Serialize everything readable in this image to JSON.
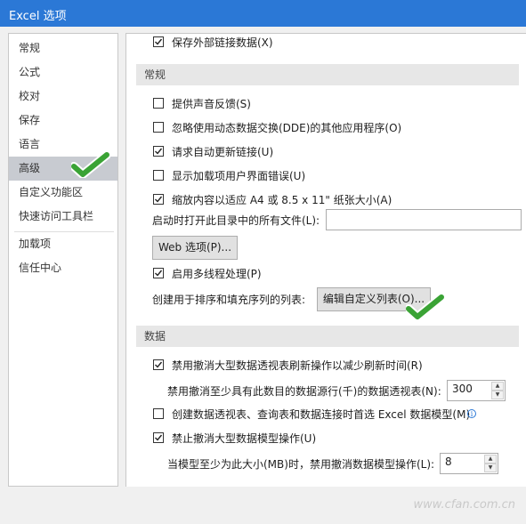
{
  "window": {
    "title": "Excel 选项"
  },
  "sidebar": {
    "items": [
      {
        "label": "常规"
      },
      {
        "label": "公式"
      },
      {
        "label": "校对"
      },
      {
        "label": "保存"
      },
      {
        "label": "语言"
      },
      {
        "label": "高级"
      },
      {
        "label": "自定义功能区"
      },
      {
        "label": "快速访问工具栏"
      },
      {
        "label": "加载项"
      },
      {
        "label": "信任中心"
      }
    ],
    "active": "高级"
  },
  "main": {
    "top_option": {
      "label": "保存外部链接数据(X)",
      "checked": true
    },
    "general": {
      "header": "常规",
      "options": [
        {
          "label": "提供声音反馈(S)",
          "checked": false
        },
        {
          "label": "忽略使用动态数据交换(DDE)的其他应用程序(O)",
          "checked": false
        },
        {
          "label": "请求自动更新链接(U)",
          "checked": true
        },
        {
          "label": "显示加载项用户界面错误(U)",
          "checked": false
        },
        {
          "label": "缩放内容以适应 A4 或 8.5 x 11\" 纸张大小(A)",
          "checked": true
        }
      ],
      "startup_label": "启动时打开此目录中的所有文件(L):",
      "startup_value": "",
      "web_options_button": "Web 选项(P)...",
      "multithread": {
        "label": "启用多线程处理(P)",
        "checked": true
      },
      "custom_list_label": "创建用于排序和填充序列的列表:",
      "custom_list_button": "编辑自定义列表(O)..."
    },
    "data": {
      "header": "数据",
      "disable_undo_pivot": {
        "label": "禁用撤消大型数据透视表刷新操作以减少刷新时间(R)",
        "checked": true
      },
      "pivot_rows_label": "禁用撤消至少具有此数目的数据源行(千)的数据透视表(N):",
      "pivot_rows_value": "300",
      "prefer_data_model": {
        "label": "创建数据透视表、查询表和数据连接时首选 Excel 数据模型(M)",
        "checked": false
      },
      "disable_undo_model": {
        "label": "禁止撤消大型数据模型操作(U)",
        "checked": true
      },
      "model_size_label": "当模型至少为此大小(MB)时，禁用撤消数据模型操作(L):",
      "model_size_value": "8"
    }
  },
  "icons": {
    "checkmark": "check-icon",
    "info": "info-icon",
    "annotation": "green-checkmark-icon"
  },
  "colors": {
    "title_bar": "#2b78d6",
    "annotation_green": "#3aa335",
    "active_item": "#c8cbd1"
  },
  "watermark": "www.cfan.com.cn"
}
